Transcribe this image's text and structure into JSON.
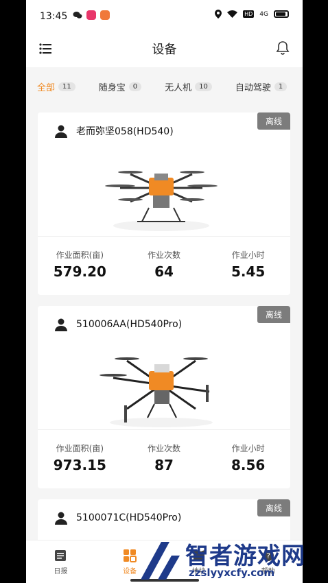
{
  "status_bar": {
    "time": "13:45",
    "hd_label": "HD",
    "signal_label": "4G"
  },
  "header": {
    "title": "设备"
  },
  "tabs": [
    {
      "label": "全部",
      "count": "11",
      "active": true
    },
    {
      "label": "随身宝",
      "count": "0",
      "active": false
    },
    {
      "label": "无人机",
      "count": "10",
      "active": false
    },
    {
      "label": "自动驾驶",
      "count": "1",
      "active": false
    }
  ],
  "devices": [
    {
      "name": "老而弥坚058(HD540)",
      "status": "离线",
      "stats": [
        {
          "label": "作业面积(亩)",
          "value": "579.20"
        },
        {
          "label": "作业次数",
          "value": "64"
        },
        {
          "label": "作业小时",
          "value": "5.45"
        }
      ]
    },
    {
      "name": "510006AA(HD540Pro)",
      "status": "离线",
      "stats": [
        {
          "label": "作业面积(亩)",
          "value": "973.15"
        },
        {
          "label": "作业次数",
          "value": "87"
        },
        {
          "label": "作业小时",
          "value": "8.56"
        }
      ]
    },
    {
      "name": "5100071C(HD540Pro)",
      "status": "离线"
    }
  ],
  "bottom_nav": [
    {
      "label": "日报",
      "icon": "report-icon",
      "active": false
    },
    {
      "label": "设备",
      "icon": "device-grid-icon",
      "active": true
    },
    {
      "label": "地块",
      "icon": "map-plot-icon",
      "active": false
    },
    {
      "label": "帮助",
      "icon": "help-icon",
      "active": false
    }
  ],
  "watermark": {
    "title": "智者游戏网",
    "url": "zzslyyxcfy.com"
  },
  "colors": {
    "accent": "#f08a24",
    "badge": "#7c7c7c"
  }
}
